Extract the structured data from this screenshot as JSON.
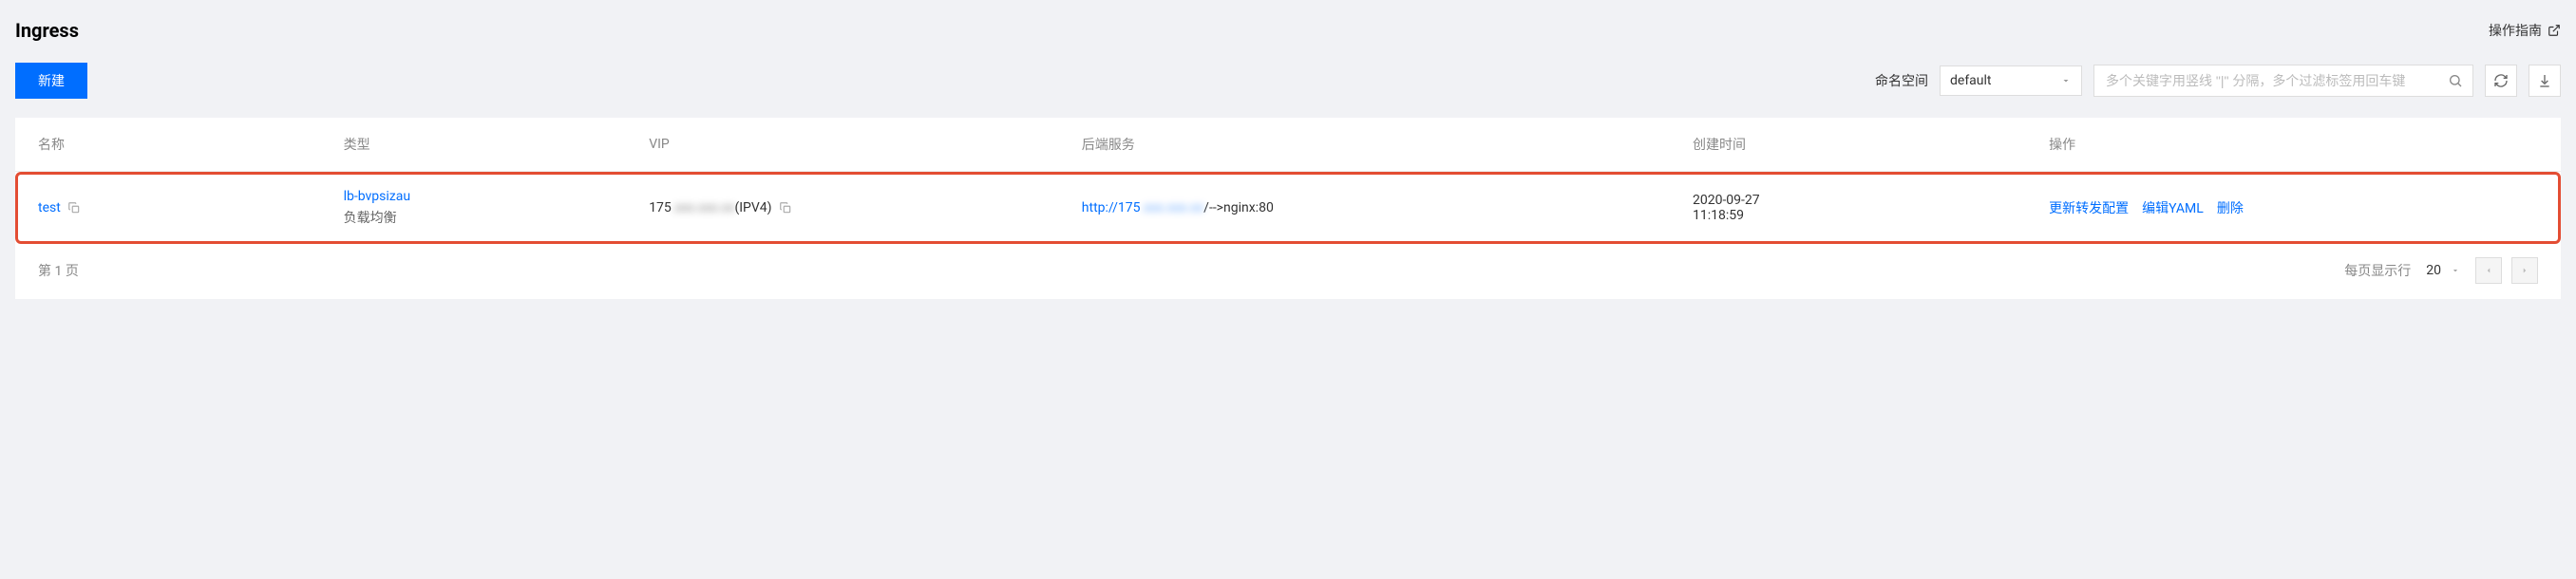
{
  "header": {
    "title": "Ingress",
    "guide_label": "操作指南"
  },
  "toolbar": {
    "new_button": "新建",
    "namespace_label": "命名空间",
    "namespace_value": "default",
    "search_placeholder": "多个关键字用竖线 \"|\" 分隔，多个过滤标签用回车键"
  },
  "table": {
    "columns": {
      "name": "名称",
      "type": "类型",
      "vip": "VIP",
      "backend": "后端服务",
      "created": "创建时间",
      "actions": "操作"
    },
    "rows": [
      {
        "name": "test",
        "type_link": "lb-bvpsizau",
        "type_sub": "负载均衡",
        "vip_prefix": "175",
        "vip_hidden": ".xxx.xxx.xx",
        "vip_suffix": "(IPV4)",
        "backend_link_prefix": "http://175",
        "backend_hidden": ".xxx.xxx.xx",
        "backend_suffix": "/-->nginx:80",
        "created_date": "2020-09-27",
        "created_time": "11:18:59",
        "actions": {
          "update": "更新转发配置",
          "edit_yaml": "编辑YAML",
          "delete": "删除"
        }
      }
    ]
  },
  "pagination": {
    "page_text": "第 1 页",
    "per_page_label": "每页显示行",
    "per_page_value": "20"
  }
}
